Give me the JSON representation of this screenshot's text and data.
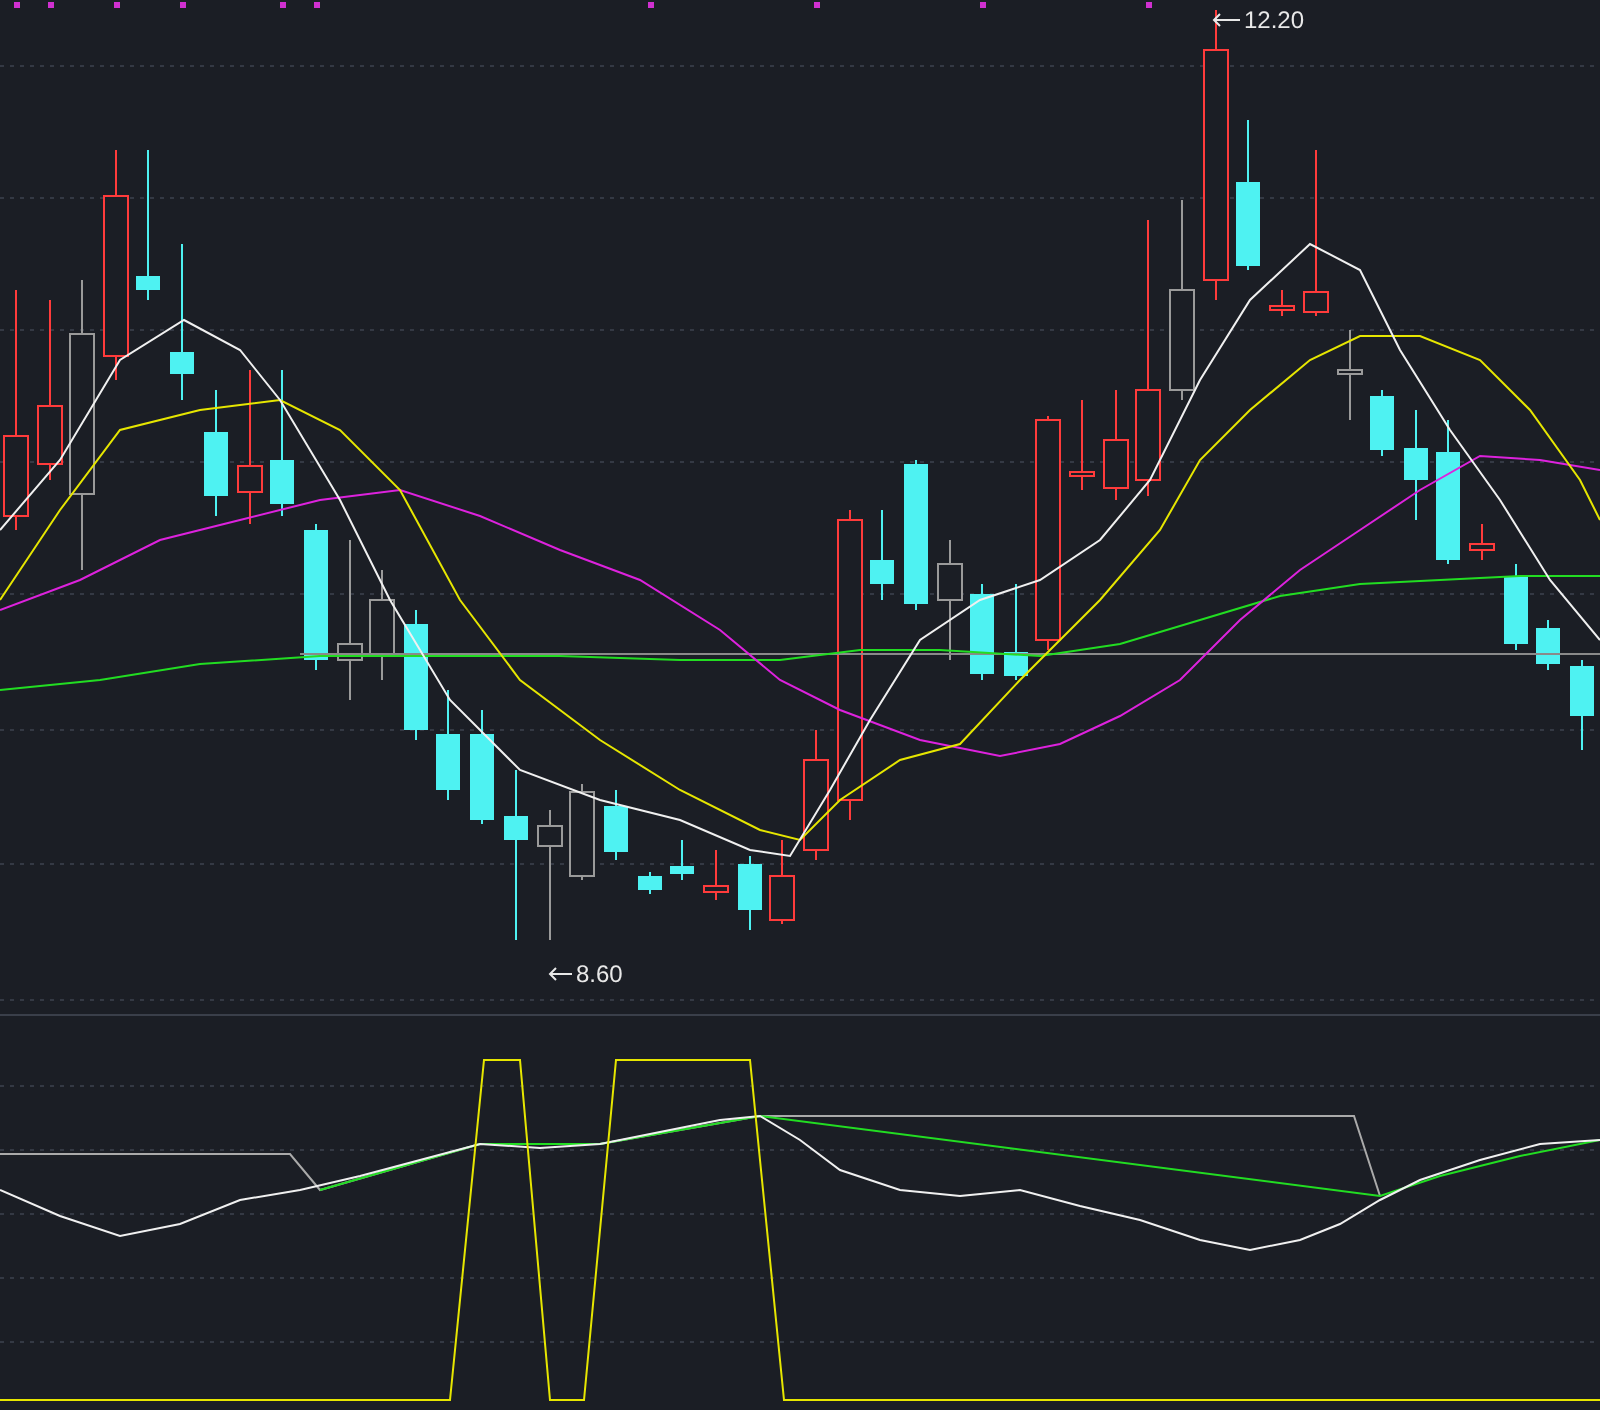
{
  "price_chart": {
    "high_label": "12.20",
    "low_label": "8.60"
  }
}
